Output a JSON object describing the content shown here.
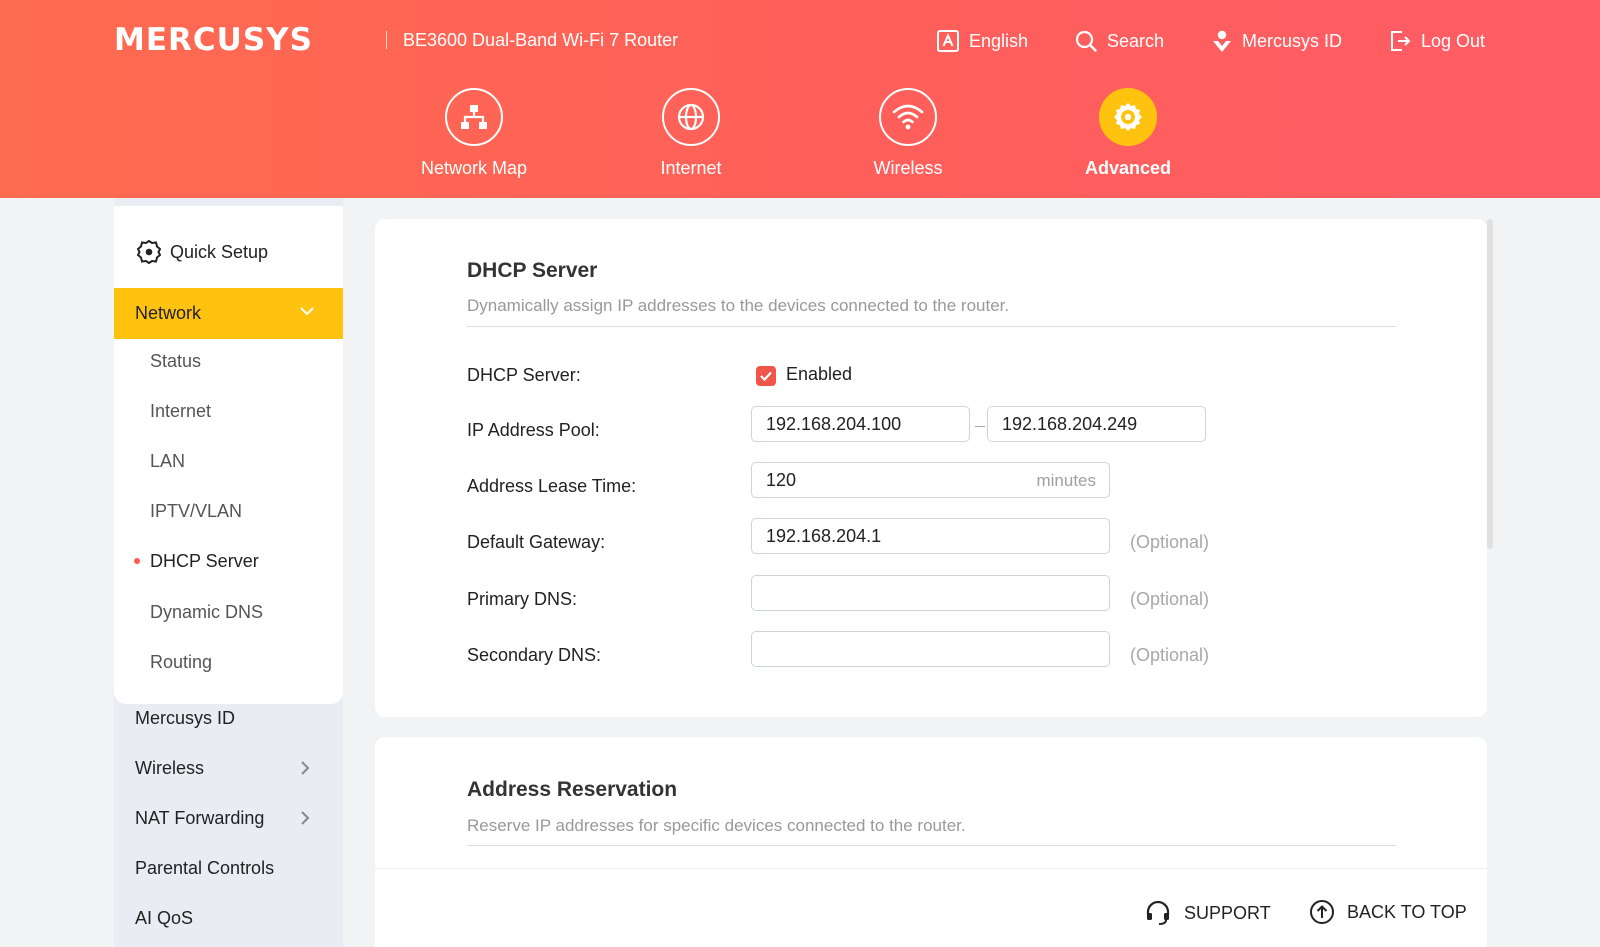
{
  "header": {
    "logo": "MERCUSYS",
    "model": "BE3600 Dual-Band Wi-Fi 7 Router",
    "links": {
      "language": "English",
      "search": "Search",
      "account": "Mercusys ID",
      "logout": "Log Out"
    },
    "nav": [
      {
        "label": "Network Map",
        "icon": "network-map-icon"
      },
      {
        "label": "Internet",
        "icon": "globe-icon"
      },
      {
        "label": "Wireless",
        "icon": "wifi-icon"
      },
      {
        "label": "Advanced",
        "icon": "gear-icon",
        "active": true
      }
    ],
    "accent": "#ffc20e",
    "header_color": "#ff6155"
  },
  "sidebar": {
    "quick_setup": "Quick Setup",
    "network": "Network",
    "network_sub": [
      {
        "label": "Status"
      },
      {
        "label": "Internet"
      },
      {
        "label": "LAN"
      },
      {
        "label": "IPTV/VLAN"
      },
      {
        "label": "DHCP Server",
        "active": true
      },
      {
        "label": "Dynamic DNS"
      },
      {
        "label": "Routing"
      }
    ],
    "items": [
      {
        "label": "Mercusys ID"
      },
      {
        "label": "Wireless",
        "expandable": true
      },
      {
        "label": "NAT Forwarding",
        "expandable": true
      },
      {
        "label": "Parental Controls"
      },
      {
        "label": "AI QoS"
      }
    ]
  },
  "dhcp": {
    "title": "DHCP Server",
    "description": "Dynamically assign IP addresses to the devices connected to the router.",
    "server_label": "DHCP Server:",
    "enabled_label": "Enabled",
    "enabled": true,
    "pool_label": "IP Address Pool:",
    "pool_start": "192.168.204.100",
    "pool_end": "192.168.204.249",
    "lease_label": "Address Lease Time:",
    "lease_value": "120",
    "lease_unit": "minutes",
    "gateway_label": "Default Gateway:",
    "gateway_value": "192.168.204.1",
    "primary_dns_label": "Primary DNS:",
    "primary_dns_value": "",
    "secondary_dns_label": "Secondary DNS:",
    "secondary_dns_value": "",
    "optional": "(Optional)"
  },
  "reservation": {
    "title": "Address Reservation",
    "description": "Reserve IP addresses for specific devices connected to the router."
  },
  "footer": {
    "support": "SUPPORT",
    "back_to_top": "BACK TO TOP"
  }
}
